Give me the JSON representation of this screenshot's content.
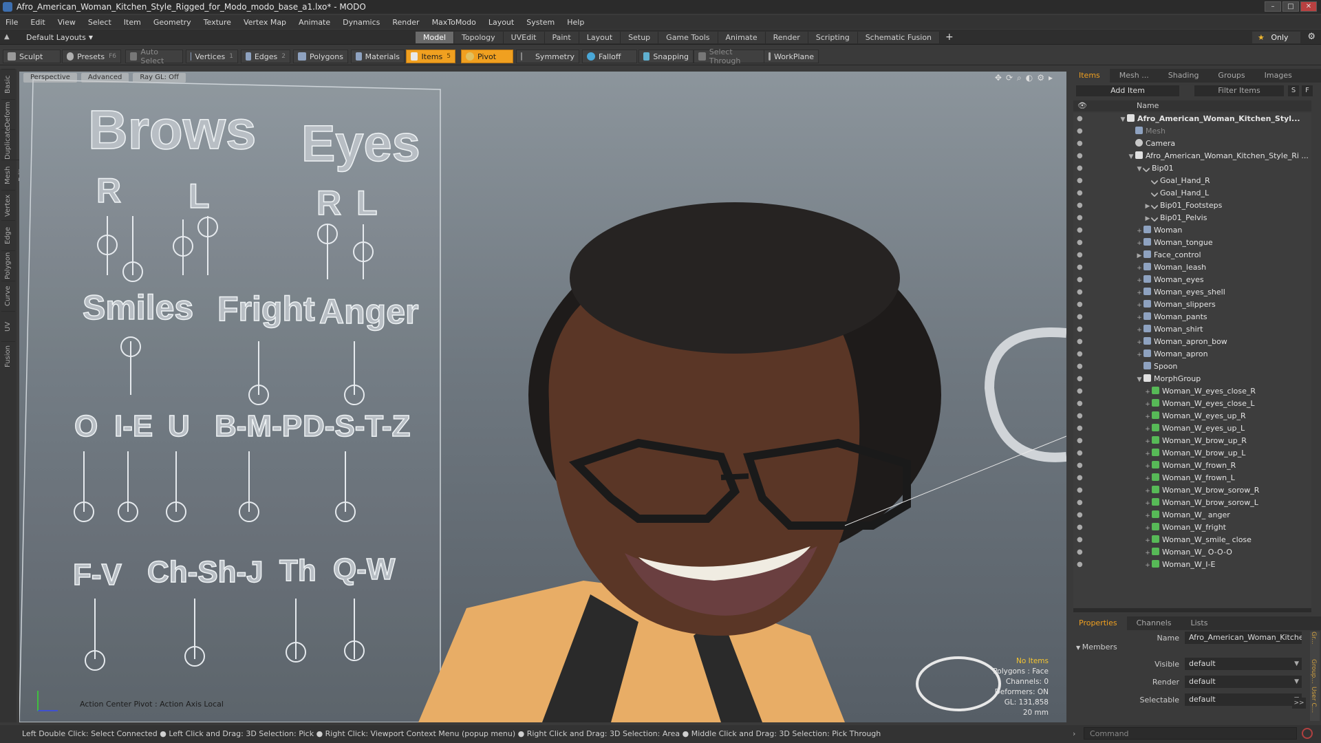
{
  "window": {
    "title": "Afro_American_Woman_Kitchen_Style_Rigged_for_Modo_modo_base_a1.lxo* - MODO"
  },
  "menu": [
    "File",
    "Edit",
    "View",
    "Select",
    "Item",
    "Geometry",
    "Texture",
    "Vertex Map",
    "Animate",
    "Dynamics",
    "Render",
    "MaxToModo",
    "Layout",
    "System",
    "Help"
  ],
  "layoutbar": {
    "selector": "Default Layouts",
    "tabs": [
      "Model",
      "Topology",
      "UVEdit",
      "Paint",
      "Layout",
      "Setup",
      "Game Tools",
      "Animate",
      "Render",
      "Scripting",
      "Schematic Fusion"
    ],
    "active_tab": "Model",
    "only_label": "Only"
  },
  "toolbar": {
    "sculpt": "Sculpt",
    "presets": "Presets",
    "presets_key": "F6",
    "auto_select": "Auto Select",
    "vertices": "Vertices",
    "vertices_key": "1",
    "edges": "Edges",
    "edges_key": "2",
    "polygons": "Polygons",
    "materials": "Materials",
    "items": "Items",
    "items_key": "5",
    "pivot": "Pivot",
    "symmetry": "Symmetry",
    "falloff": "Falloff",
    "snapping": "Snapping",
    "select_through": "Select Through",
    "workplane": "WorkPlane"
  },
  "left_tabs": [
    "Basic",
    "Deform",
    "Duplicate",
    "Mesh Edit",
    "Vertex",
    "Edge",
    "Polygon",
    "Curve",
    "UV",
    "Fusion"
  ],
  "viewport": {
    "perspective": "Perspective",
    "advanced": "Advanced",
    "raygl": "Ray GL: Off",
    "action_pivot": "Action Center Pivot : Action Axis Local",
    "info": {
      "no_items": "No Items",
      "polygons": "Polygons : Face",
      "channels": "Channels: 0",
      "deformers": "Deformers: ON",
      "gl": "GL: 131,858",
      "scale": "20 mm"
    },
    "rig_labels": [
      "Brows",
      "Eyes",
      "R",
      "L",
      "R",
      "L",
      "Smiles",
      "Fright",
      "Anger",
      "O",
      "I-E",
      "U",
      "B-M-P",
      "D-S-T-Z",
      "F-V",
      "Ch-Sh-J",
      "Th",
      "Q-W"
    ]
  },
  "outliner": {
    "tabs": [
      "Items",
      "Mesh ...",
      "Shading",
      "Groups",
      "Images"
    ],
    "active_tab": "Items",
    "add_item": "Add Item",
    "filter_items": "Filter Items",
    "s_btn": "S",
    "f_btn": "F",
    "name_col": "Name",
    "rows": [
      {
        "label": "Afro_American_Woman_Kitchen_Styl...",
        "depth": 0,
        "tw": "▼",
        "icon": "group",
        "bold": true
      },
      {
        "label": "Mesh",
        "depth": 1,
        "tw": "",
        "icon": "mesh",
        "dim": true
      },
      {
        "label": "Camera",
        "depth": 1,
        "tw": "",
        "icon": "cam"
      },
      {
        "label": "Afro_American_Woman_Kitchen_Style_Ri ...",
        "depth": 1,
        "tw": "▼",
        "icon": "group"
      },
      {
        "label": "Bip01",
        "depth": 2,
        "tw": "▼",
        "icon": "bone"
      },
      {
        "label": "Goal_Hand_R",
        "depth": 3,
        "tw": "",
        "icon": "bone"
      },
      {
        "label": "Goal_Hand_L",
        "depth": 3,
        "tw": "",
        "icon": "bone"
      },
      {
        "label": "Bip01_Footsteps",
        "depth": 3,
        "tw": "▶",
        "icon": "bone"
      },
      {
        "label": "Bip01_Pelvis",
        "depth": 3,
        "tw": "▶",
        "icon": "bone"
      },
      {
        "label": "Woman",
        "depth": 2,
        "tw": "+",
        "icon": "mesh"
      },
      {
        "label": "Woman_tongue",
        "depth": 2,
        "tw": "+",
        "icon": "mesh"
      },
      {
        "label": "Face_control",
        "depth": 2,
        "tw": "▶",
        "icon": "mesh"
      },
      {
        "label": "Woman_leash",
        "depth": 2,
        "tw": "+",
        "icon": "mesh"
      },
      {
        "label": "Woman_eyes",
        "depth": 2,
        "tw": "+",
        "icon": "mesh"
      },
      {
        "label": "Woman_eyes_shell",
        "depth": 2,
        "tw": "+",
        "icon": "mesh"
      },
      {
        "label": "Woman_slippers",
        "depth": 2,
        "tw": "+",
        "icon": "mesh"
      },
      {
        "label": "Woman_pants",
        "depth": 2,
        "tw": "+",
        "icon": "mesh"
      },
      {
        "label": "Woman_shirt",
        "depth": 2,
        "tw": "+",
        "icon": "mesh"
      },
      {
        "label": "Woman_apron_bow",
        "depth": 2,
        "tw": "+",
        "icon": "mesh"
      },
      {
        "label": "Woman_apron",
        "depth": 2,
        "tw": "+",
        "icon": "mesh"
      },
      {
        "label": "Spoon",
        "depth": 2,
        "tw": "",
        "icon": "mesh"
      },
      {
        "label": "MorphGroup",
        "depth": 2,
        "tw": "▼",
        "icon": "group"
      },
      {
        "label": "Woman_W_eyes_close_R",
        "depth": 3,
        "tw": "+",
        "icon": "morph"
      },
      {
        "label": "Woman_W_eyes_close_L",
        "depth": 3,
        "tw": "+",
        "icon": "morph"
      },
      {
        "label": "Woman_W_eyes_up_R",
        "depth": 3,
        "tw": "+",
        "icon": "morph"
      },
      {
        "label": "Woman_W_eyes_up_L",
        "depth": 3,
        "tw": "+",
        "icon": "morph"
      },
      {
        "label": "Woman_W_brow_up_R",
        "depth": 3,
        "tw": "+",
        "icon": "morph"
      },
      {
        "label": "Woman_W_brow_up_L",
        "depth": 3,
        "tw": "+",
        "icon": "morph"
      },
      {
        "label": "Woman_W_frown_R",
        "depth": 3,
        "tw": "+",
        "icon": "morph"
      },
      {
        "label": "Woman_W_frown_L",
        "depth": 3,
        "tw": "+",
        "icon": "morph"
      },
      {
        "label": "Woman_W_brow_sorow_R",
        "depth": 3,
        "tw": "+",
        "icon": "morph"
      },
      {
        "label": "Woman_W_brow_sorow_L",
        "depth": 3,
        "tw": "+",
        "icon": "morph"
      },
      {
        "label": "Woman_W_ anger",
        "depth": 3,
        "tw": "+",
        "icon": "morph"
      },
      {
        "label": "Woman_W_fright",
        "depth": 3,
        "tw": "+",
        "icon": "morph"
      },
      {
        "label": "Woman_W_smile_ close",
        "depth": 3,
        "tw": "+",
        "icon": "morph"
      },
      {
        "label": "Woman_W_ O-O-O",
        "depth": 3,
        "tw": "+",
        "icon": "morph"
      },
      {
        "label": "Woman_W_I-E",
        "depth": 3,
        "tw": "+",
        "icon": "morph"
      }
    ]
  },
  "properties": {
    "tabs": [
      "Properties",
      "Channels",
      "Lists"
    ],
    "active_tab": "Properties",
    "name_label": "Name",
    "name_value": "Afro_American_Woman_Kitchen_Style_R",
    "members": "Members",
    "visible_label": "Visible",
    "visible_value": "default",
    "render_label": "Render",
    "render_value": "default",
    "selectable_label": "Selectable",
    "selectable_value": "default",
    "expand": ">>",
    "side_tabs": [
      "Gr...",
      "Group...",
      "User C..."
    ]
  },
  "statusbar": {
    "hints": "Left Double Click: Select Connected ● Left Click and Drag: 3D Selection: Pick ● Right Click: Viewport Context Menu (popup menu) ● Right Click and Drag: 3D Selection: Area ● Middle Click and Drag: 3D Selection: Pick Through",
    "command_placeholder": "Command"
  },
  "colors": {
    "accent": "#f0a020",
    "background": "#3a3a3a",
    "viewport_top": "#8c959c",
    "viewport_bottom": "#565e66"
  }
}
